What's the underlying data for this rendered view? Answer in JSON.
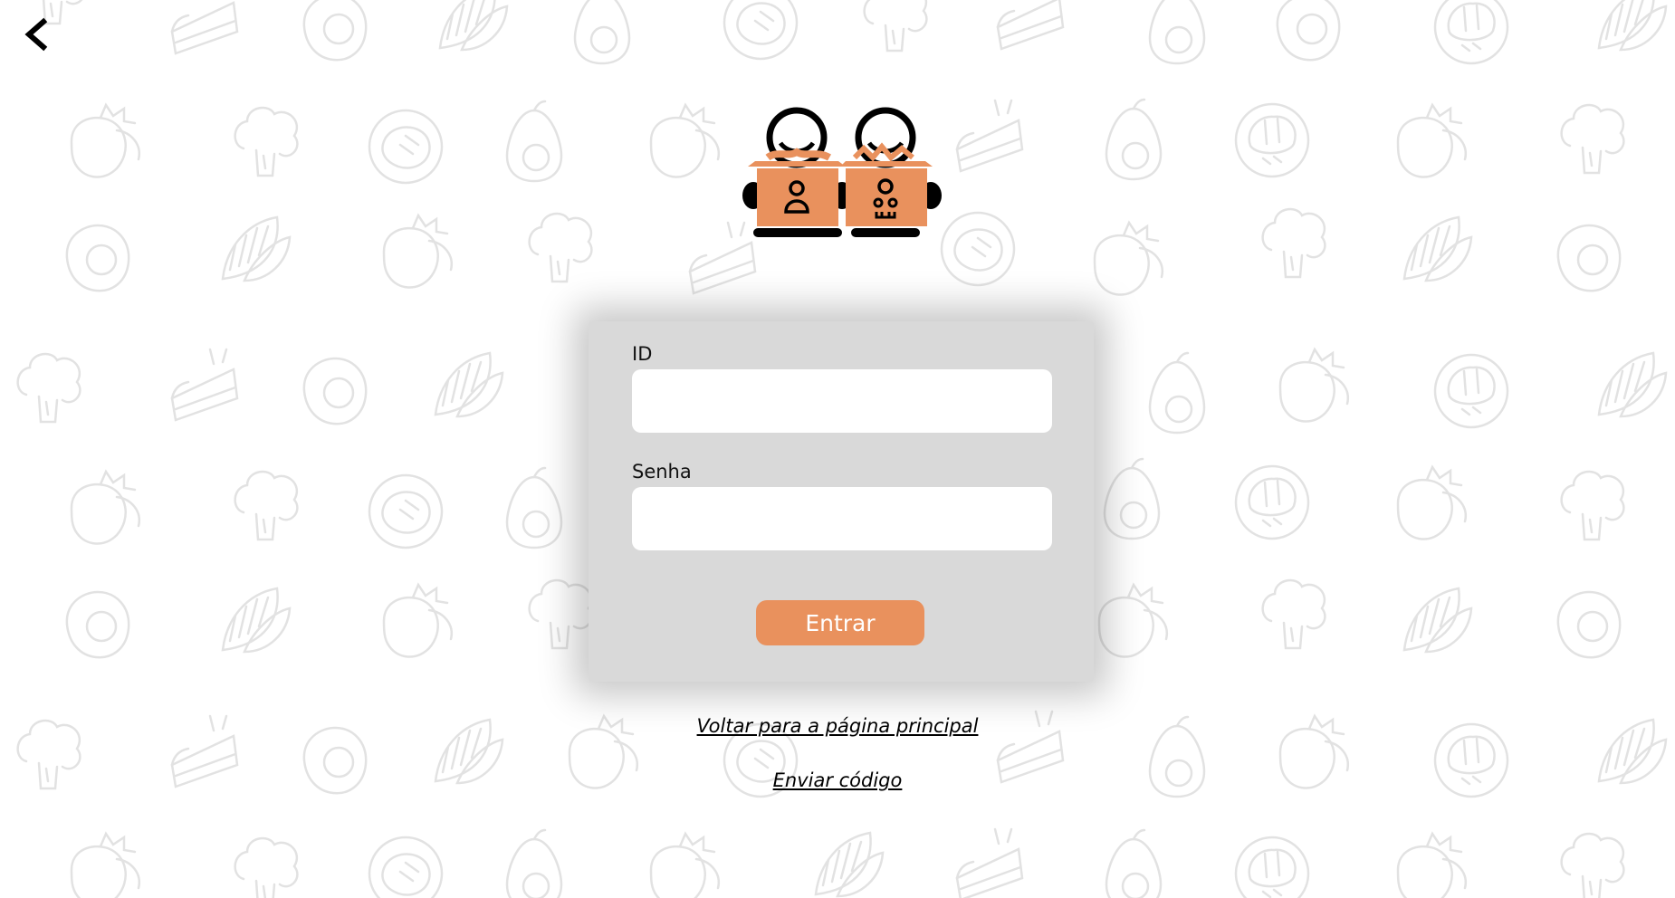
{
  "header": {
    "back_icon": "chevron-left-icon"
  },
  "logo": {
    "icon": "delivery-mascots-logo",
    "accent_color": "#e9915d"
  },
  "login_form": {
    "id_label": "ID",
    "id_value": "",
    "password_label": "Senha",
    "password_value": "",
    "submit_label": "Entrar",
    "button_color": "#e9915d",
    "card_color": "#d9d9d9"
  },
  "links": {
    "home_label": "Voltar para a página principal",
    "send_code_label": "Enviar código"
  },
  "background": {
    "pattern": "food-icons-line-art",
    "icons": [
      "strawberry-icon",
      "broccoli-icon",
      "steak-icon",
      "avocado-icon",
      "egg-icon",
      "almond-icon",
      "cake-slice-icon",
      "brain-icon"
    ]
  }
}
